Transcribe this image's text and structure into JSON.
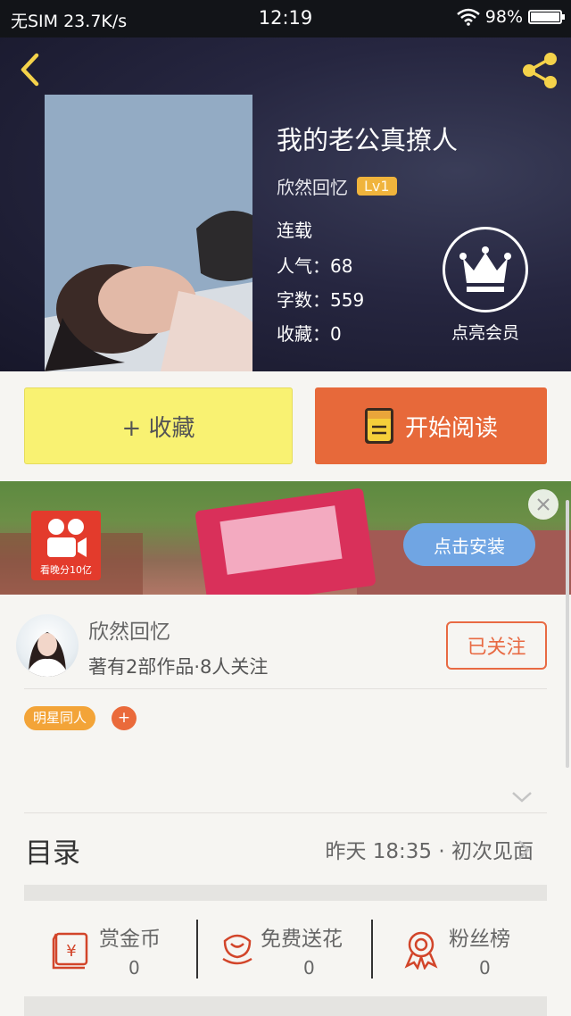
{
  "status_bar": {
    "carrier": "无SIM 23.7K/s",
    "time": "12:19",
    "battery": "98%"
  },
  "header": {
    "back_icon": "chevron-left-icon",
    "share_icon": "share-icon"
  },
  "book": {
    "title": "我的老公真撩人",
    "author": "欣然回忆",
    "level": "Lv1",
    "status": "连载",
    "popularity": "人气：68",
    "word_count": "字数：559",
    "favorites": "收藏：0"
  },
  "vip": {
    "label": "点亮会员",
    "icon": "crown-icon"
  },
  "actions": {
    "collect_label": "+ 收藏",
    "read_label": "开始阅读",
    "read_icon": "book-icon"
  },
  "ad": {
    "logo_caption": "看晚分10亿",
    "install_label": "点击安装",
    "close_icon": "close-icon"
  },
  "author_card": {
    "name": "欣然回忆",
    "meta": "著有2部作品·8人关注",
    "follow_label": "已关注"
  },
  "tags": {
    "items": [
      "明星同人"
    ],
    "add_label": "+"
  },
  "catalog": {
    "title": "目录",
    "latest": "昨天 18:35 · 初次见面"
  },
  "bottom_actions": [
    {
      "label": "赏金币",
      "count": "0",
      "icon": "coin-envelope-icon"
    },
    {
      "label": "免费送花",
      "count": "0",
      "icon": "flower-icon"
    },
    {
      "label": "粉丝榜",
      "count": "0",
      "icon": "medal-icon"
    }
  ],
  "colors": {
    "accent_orange": "#e7693a",
    "collect_yellow": "#f9f272",
    "level_badge": "#f0b43c",
    "tag_orange": "#f3a438"
  }
}
